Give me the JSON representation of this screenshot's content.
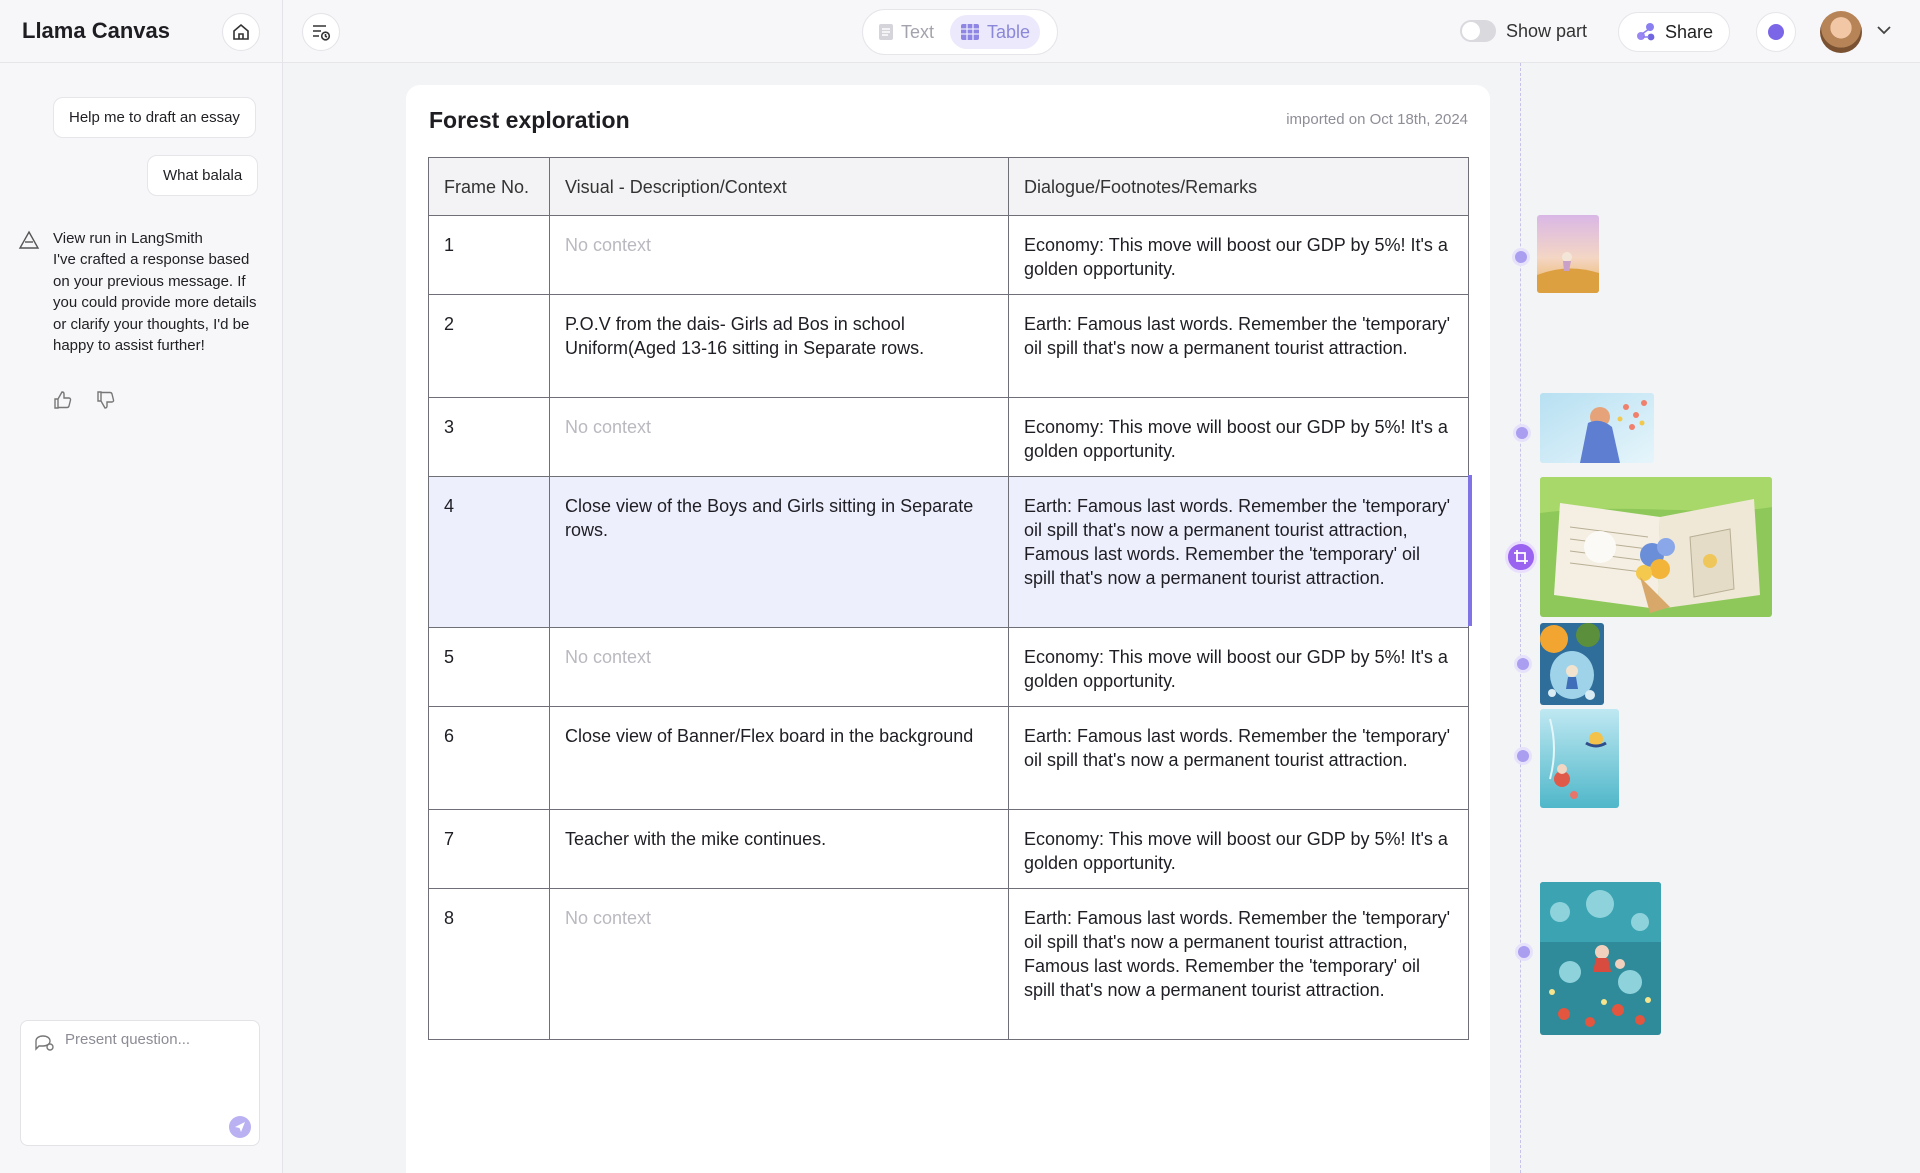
{
  "app": {
    "title": "Llama Canvas"
  },
  "header": {
    "mode_text": "Text",
    "mode_table": "Table",
    "active_mode": "Table",
    "show_part_label": "Show part",
    "share_label": "Share",
    "icons": [
      "home-icon",
      "history-icon",
      "document-icon",
      "table-icon",
      "share-icon",
      "chevron-down-icon"
    ]
  },
  "chat": {
    "user_messages": [
      "Help me to draft an essay",
      "What balala"
    ],
    "bot_response": "View run in LangSmith\nI've crafted a response based on your previous message. If you could provide more details or clarify your thoughts, I'd be happy to assist further!",
    "composer_placeholder": "Present question..."
  },
  "document": {
    "title": "Forest exploration",
    "imported": "imported on Oct 18th, 2024",
    "columns": [
      "Frame No.",
      "Visual - Description/Context",
      "Dialogue/Footnotes/Remarks"
    ],
    "rows": [
      {
        "frame": "1",
        "visual": "No context",
        "dialogue": "Economy: This move will boost our GDP by 5%! It's a golden opportunity."
      },
      {
        "frame": "2",
        "visual": "P.O.V from the dais- Girls ad Bos in school Uniform(Aged 13-16 sitting in Separate rows.",
        "dialogue": "Earth: Famous last words. Remember the 'temporary' oil spill that's now a permanent tourist attraction."
      },
      {
        "frame": "3",
        "visual": "No context",
        "dialogue": "Economy: This move will boost our GDP by 5%! It's a golden opportunity."
      },
      {
        "frame": "4",
        "visual": "Close view of the  Boys and Girls sitting  in Separate rows.",
        "dialogue": "Earth: Famous last words. Remember the 'temporary' oil spill that's now a permanent tourist attraction, Famous last words. Remember the 'temporary' oil spill that's now a permanent tourist attraction."
      },
      {
        "frame": "5",
        "visual": "No context",
        "dialogue": "Economy: This move will boost our GDP by 5%! It's a golden opportunity."
      },
      {
        "frame": "6",
        "visual": "Close view of  Banner/Flex board in the background",
        "dialogue": "Earth: Famous last words. Remember the 'temporary' oil spill that's now a permanent tourist attraction."
      },
      {
        "frame": "7",
        "visual": "Teacher with the mike continues.",
        "dialogue": "Economy: This move will boost our GDP by 5%! It's a golden opportunity."
      },
      {
        "frame": "8",
        "visual": "No context",
        "dialogue": "Earth: Famous last words. Remember the 'temporary' oil spill that's now a permanent tourist attraction, Famous last words. Remember the 'temporary' oil spill that's now a permanent tourist attraction."
      }
    ],
    "selected_frame": "4",
    "empty_visual_text": "No context"
  },
  "colors": {
    "accent": "#8b87d9",
    "accent_strong": "#7f73e6",
    "highlight_row": "#eeeffc"
  }
}
